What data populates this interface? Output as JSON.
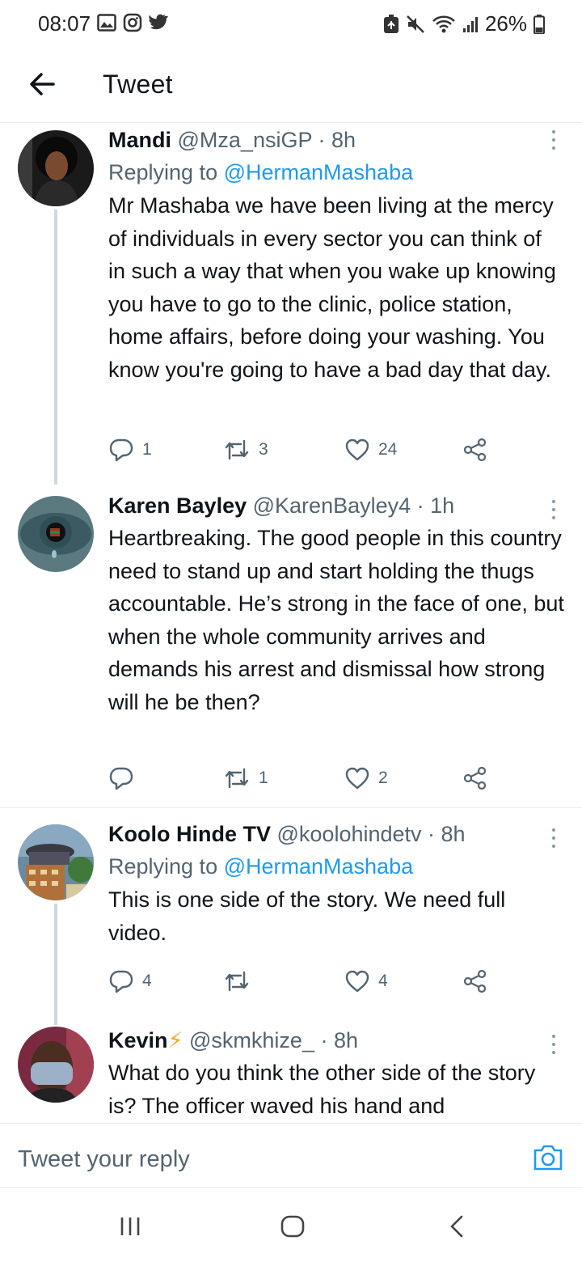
{
  "status_bar": {
    "time": "08:07",
    "battery": "26%",
    "left_icons": [
      "gallery-icon",
      "instagram-icon",
      "twitter-icon"
    ],
    "right_icons": [
      "battery-saver-icon",
      "mute-icon",
      "wifi-icon",
      "signal-icon",
      "battery-icon"
    ]
  },
  "header": {
    "title": "Tweet"
  },
  "tweets": [
    {
      "name": "Mandi",
      "handle": "@Mza_nsiGP",
      "time": "· 8h",
      "replying_prefix": "Replying to ",
      "replying_to": "@HermanMashaba",
      "text": "Mr Mashaba we have been living at the mercy of individuals in every sector you can think of in such a way that when you wake up knowing you have to go to the clinic, police station, home affairs, before doing your washing. You know you're going to have a bad day that day.",
      "replies": "1",
      "retweets": "3",
      "likes": "24"
    },
    {
      "name": "Karen Bayley",
      "handle": "@KarenBayley4",
      "time": "· 1h",
      "text": "Heartbreaking. The good people in this country need to stand up and start holding the thugs accountable. He’s strong in the face of one, but when the whole community arrives and demands his arrest and dismissal how strong will he be then?",
      "replies": "",
      "retweets": "1",
      "likes": "2"
    },
    {
      "name": "Koolo Hinde TV",
      "handle": "@koolohindetv",
      "time": "· 8h",
      "replying_prefix": "Replying to ",
      "replying_to": "@HermanMashaba",
      "text": "This is one side of the story. We need full video.",
      "replies": "4",
      "retweets": "",
      "likes": "4"
    },
    {
      "name": "Kevin",
      "name_emoji": "⚡",
      "handle": "@skmkhize_",
      "time": "· 8h",
      "text": "What do you think the other side of the story is? The officer waved his hand and"
    }
  ],
  "reply_bar": {
    "placeholder": "Tweet your reply"
  },
  "colors": {
    "accent": "#1d9bf0",
    "secondary_text": "#536471",
    "divider": "#e6ecf0",
    "emoji_bolt": "#f5a623"
  }
}
